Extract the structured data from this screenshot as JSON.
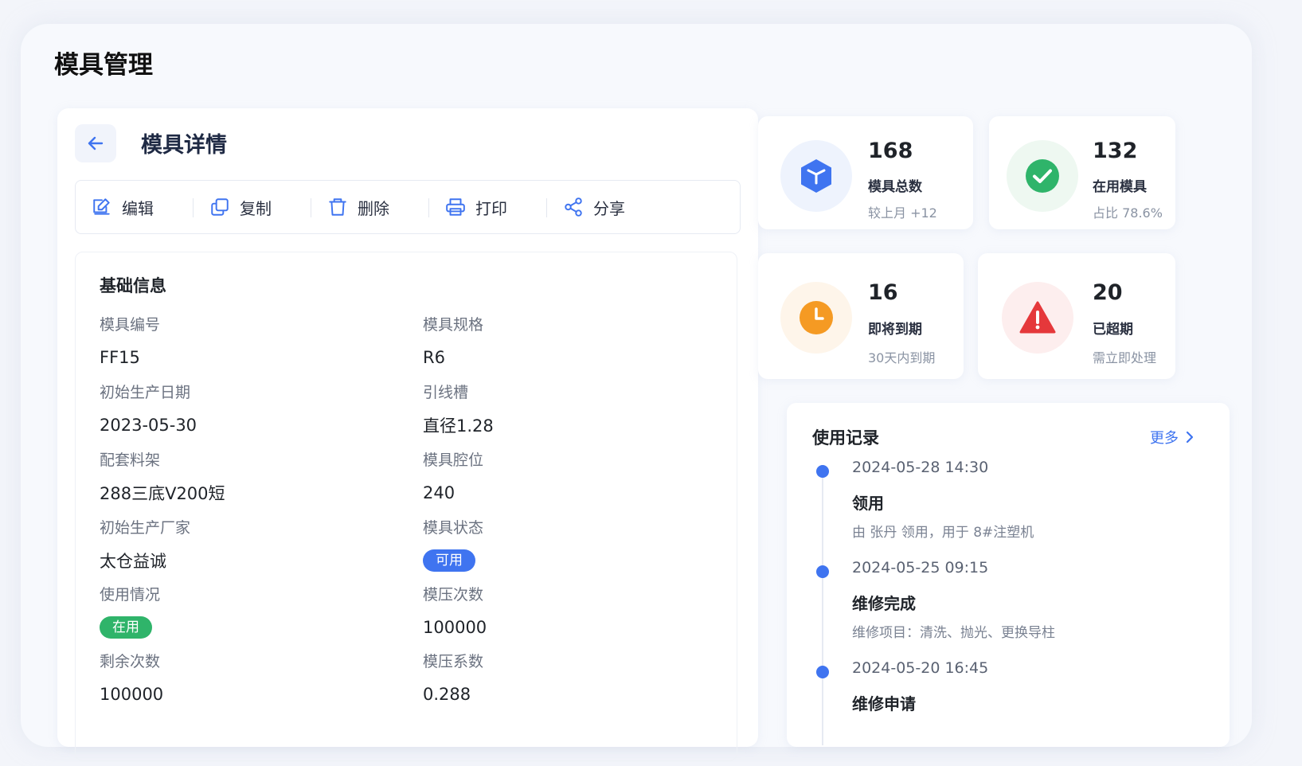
{
  "page": {
    "title": "模具管理"
  },
  "detail": {
    "title": "模具详情",
    "toolbar": [
      {
        "label": "编辑",
        "icon": "edit-icon"
      },
      {
        "label": "复制",
        "icon": "copy-icon"
      },
      {
        "label": "删除",
        "icon": "trash-icon"
      },
      {
        "label": "打印",
        "icon": "printer-icon"
      },
      {
        "label": "分享",
        "icon": "share-icon"
      }
    ],
    "section_title": "基础信息",
    "fields": {
      "mold_no": {
        "label": "模具编号",
        "value": "FF15"
      },
      "spec": {
        "label": "模具规格",
        "value": "R6"
      },
      "prod_date": {
        "label": "初始生产日期",
        "value": "2023-05-30"
      },
      "lead_groove": {
        "label": "引线槽",
        "value": "直径1.28"
      },
      "rack": {
        "label": "配套料架",
        "value": "288三底V200短"
      },
      "cavity": {
        "label": "模具腔位",
        "value": "240"
      },
      "maker": {
        "label": "初始生产厂家",
        "value": "太仓益诚"
      },
      "status": {
        "label": "模具状态",
        "value": "可用"
      },
      "usage": {
        "label": "使用情况",
        "value": "在用"
      },
      "press_count": {
        "label": "模压次数",
        "value": "100000"
      },
      "remaining": {
        "label": "剩余次数",
        "value": "100000"
      },
      "press_coef": {
        "label": "模压系数",
        "value": "0.288"
      }
    }
  },
  "stats": [
    {
      "num": "168",
      "label": "模具总数",
      "sub": "较上月 +12",
      "icon": "cube-icon",
      "color": "#3f74f0"
    },
    {
      "num": "132",
      "label": "在用模具",
      "sub": "占比 78.6%",
      "icon": "check-circle-icon",
      "color": "#2fb46a"
    },
    {
      "num": "16",
      "label": "即将到期",
      "sub": "30天内到期",
      "icon": "clock-icon",
      "color": "#f59a23"
    },
    {
      "num": "20",
      "label": "已超期",
      "sub": "需立即处理",
      "icon": "warning-icon",
      "color": "#e5383b"
    }
  ],
  "usage_log": {
    "title": "使用记录",
    "more": "更多",
    "items": [
      {
        "time": "2024-05-28 14:30",
        "action": "领用",
        "desc": "由 张丹 领用，用于 8#注塑机"
      },
      {
        "time": "2024-05-25 09:15",
        "action": "维修完成",
        "desc": "维修项目：清洗、抛光、更换导柱"
      },
      {
        "time": "2024-05-20 16:45",
        "action": "维修申请",
        "desc": ""
      }
    ]
  }
}
